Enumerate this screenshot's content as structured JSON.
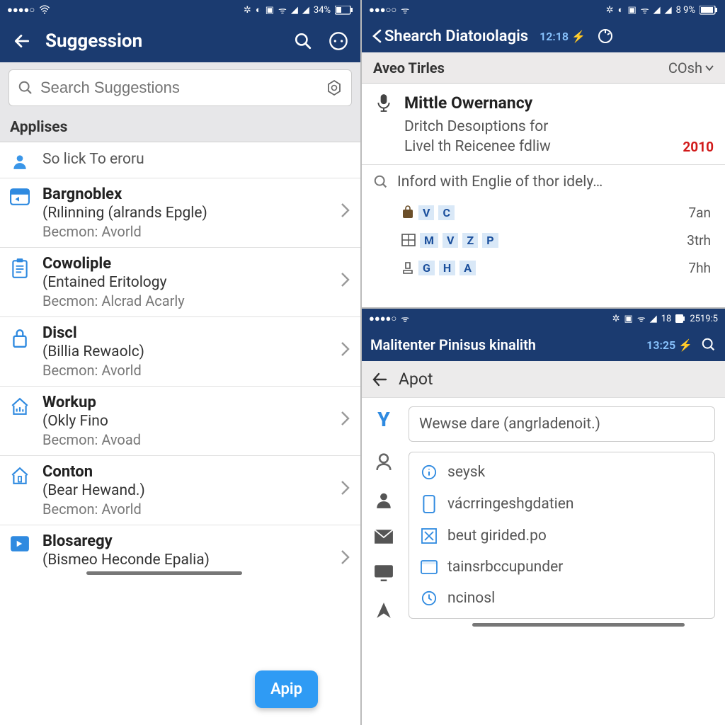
{
  "left": {
    "status": {
      "battery": "34%"
    },
    "title": "Suggession",
    "search_placeholder": "Search Suggestions",
    "section": "Applises",
    "simple_row": "So lick To eroru",
    "items": [
      {
        "title": "Bargnoblex",
        "sub": "(Rılinning (alrands Epgle)",
        "meta": "Becmon: Avorld"
      },
      {
        "title": "Cowoliple",
        "sub": "(Entained Eritology",
        "meta": "Becmon: Alcrad Acarly"
      },
      {
        "title": "Discl",
        "sub": "(Billia Rewaolc)",
        "meta": "Becmon: Avorld"
      },
      {
        "title": "Workup",
        "sub": "(Okly Fino",
        "meta": "Becmon: Avoad"
      },
      {
        "title": "Conton",
        "sub": "(Bear Hewand.)",
        "meta": "Becmon: Avorld"
      },
      {
        "title": "Blosaregy",
        "sub": "(Bismeo Heconde Epalia)",
        "meta": ""
      }
    ],
    "fab": "Apip"
  },
  "right_top": {
    "status": {
      "battery": "8 9%"
    },
    "back_title": "Shearch Diatoıolagis",
    "time": "12:18",
    "subhead": "Aveo Tirles",
    "dropdown": "COsh",
    "card": {
      "title": "Mittle Owernancy",
      "desc1": "Dritch Desoıptions for",
      "desc2": "Livel th Reicenee fdliw",
      "year": "2010"
    },
    "search_row": "Inford with Englie of thor idely…",
    "minis": [
      {
        "tags": [
          "V",
          "C"
        ],
        "right": "7an"
      },
      {
        "tags": [
          "M",
          "V",
          "Z",
          "P"
        ],
        "right": "3trh"
      },
      {
        "tags": [
          "G",
          "H",
          "A"
        ],
        "right": "7hh"
      }
    ]
  },
  "right_bottom": {
    "status": {
      "battery": "",
      "signal": "18",
      "time": "2519:5"
    },
    "title": "Malitenter Pinisus kinalith",
    "time": "13:25",
    "back_label": "Apot",
    "input_text": "Wewse dare (angrladenoit.)",
    "options": [
      "seysk",
      "vácrringeshgdatien",
      "beut girided.po",
      "tainsrbccupunder",
      "ncinosl"
    ]
  }
}
